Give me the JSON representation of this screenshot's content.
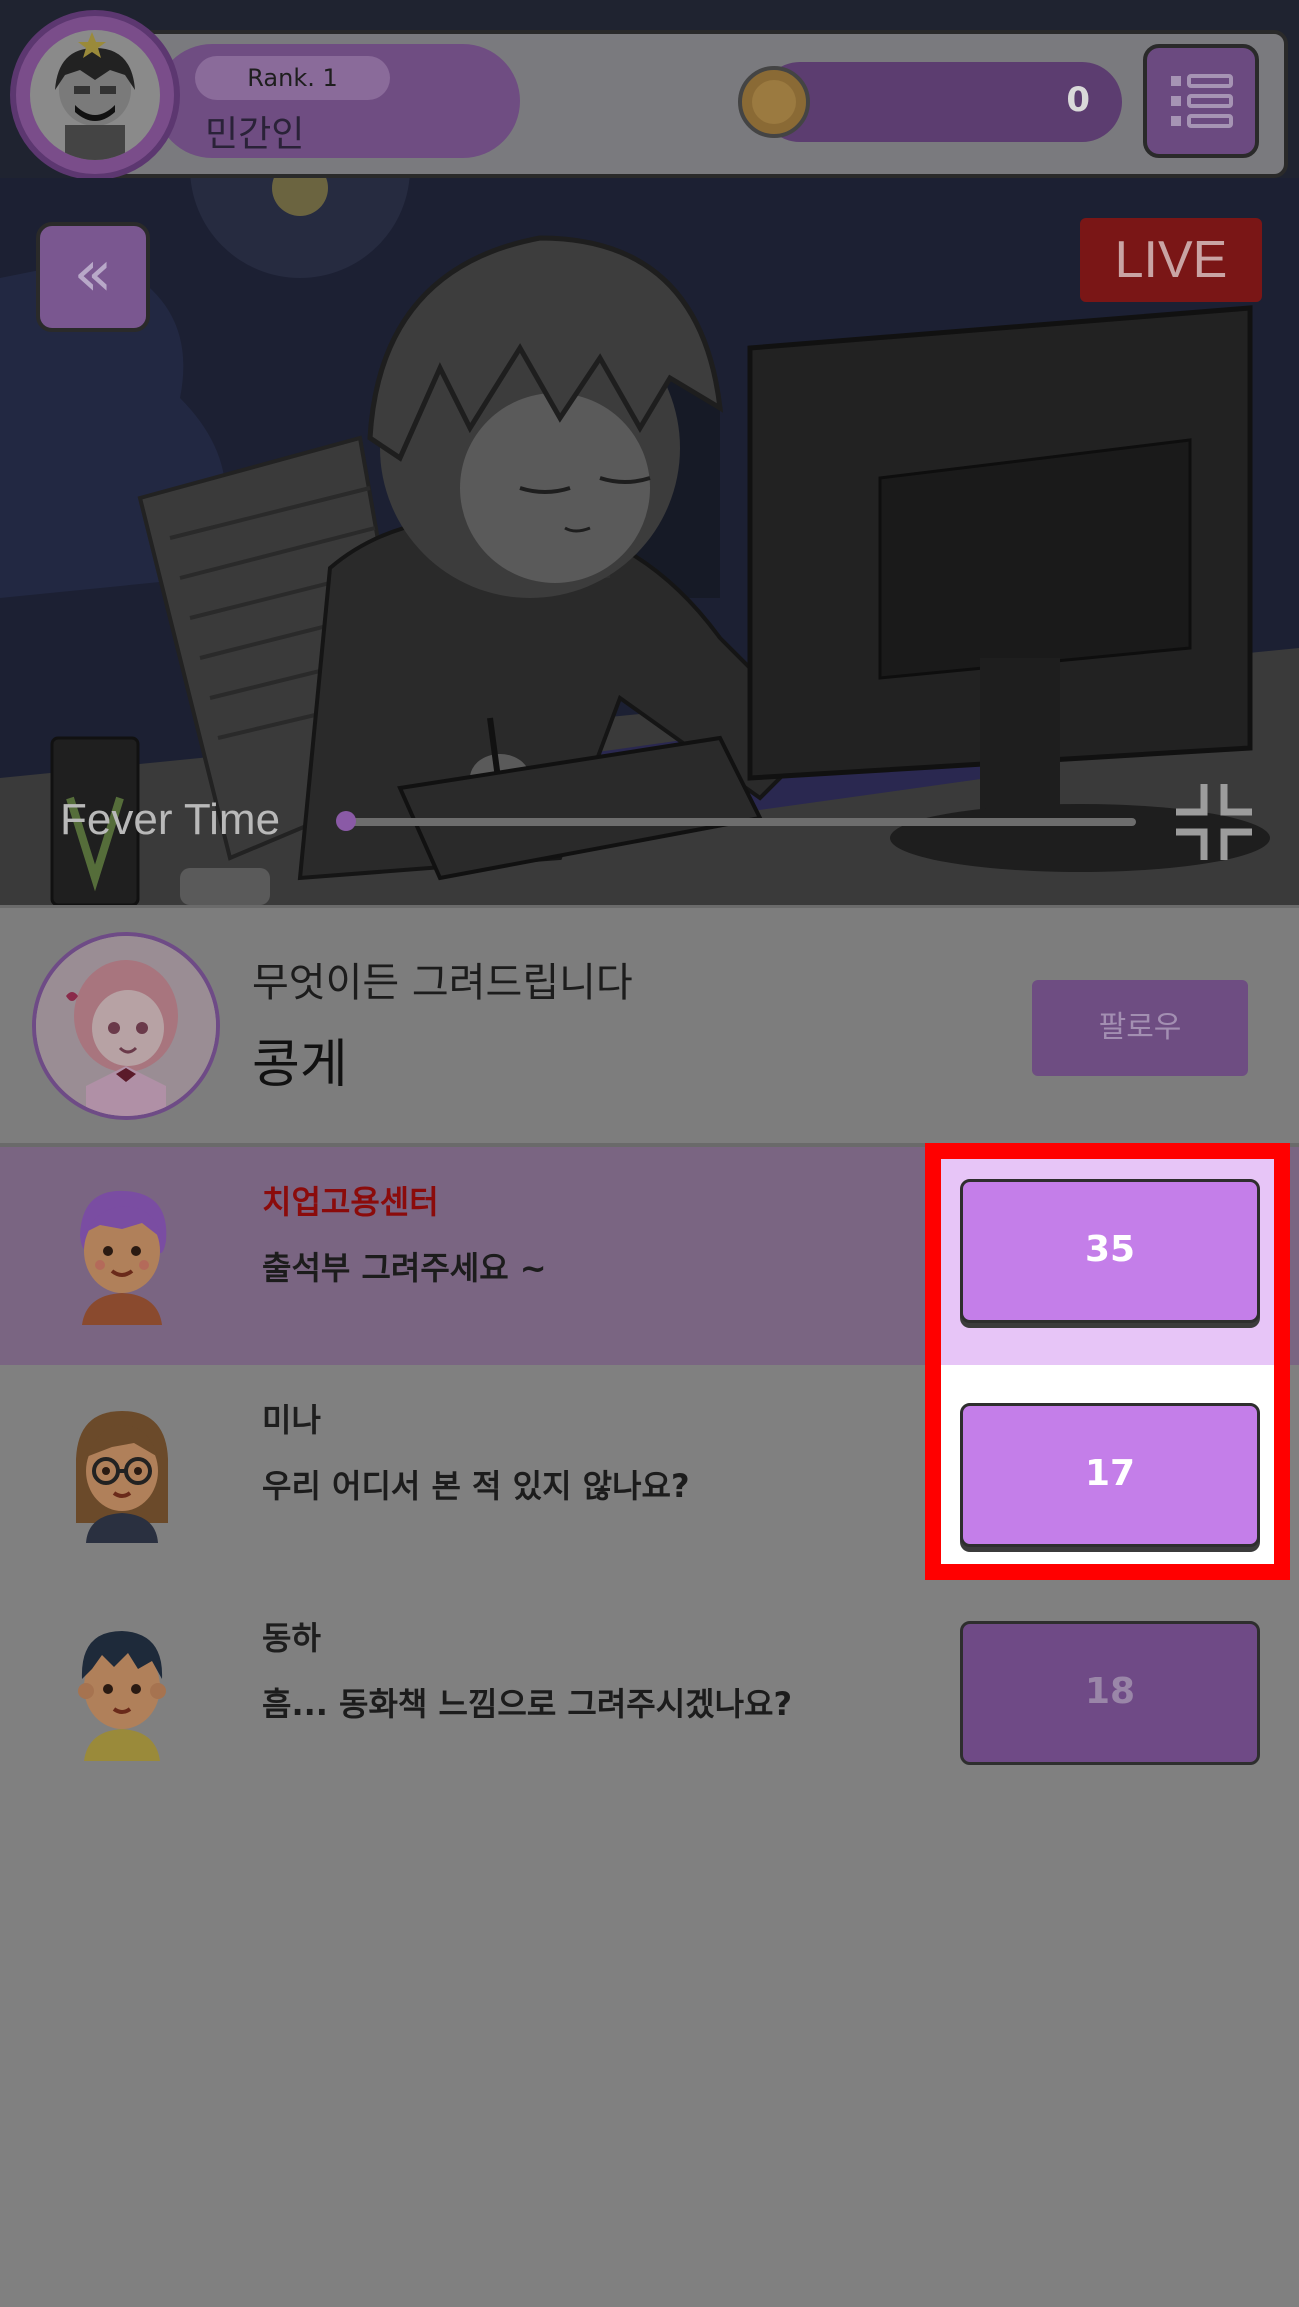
{
  "header": {
    "rank_label": "Rank. 1",
    "user_name": "민간인",
    "coin_value": "0"
  },
  "stream": {
    "live_label": "LIVE",
    "fever_label": "Fever Time",
    "fever_progress": 0
  },
  "streamer": {
    "title": "무엇이든 그려드립니다",
    "name": "콩게",
    "follow_label": "팔로우"
  },
  "chat": [
    {
      "user": "치업고용센터",
      "message": "출석부 그려주세요 ~",
      "reward": "35"
    },
    {
      "user": "미나",
      "message": "우리 어디서 본 적 있지 않나요?",
      "reward": "17"
    },
    {
      "user": "동하",
      "message": "흠... 동화책 느낌으로 그려주시겠나요?",
      "reward": "18"
    }
  ],
  "colors": {
    "accent_purple": "#c47ee9",
    "live_red": "#7a1616",
    "highlight": "#ff0000"
  }
}
